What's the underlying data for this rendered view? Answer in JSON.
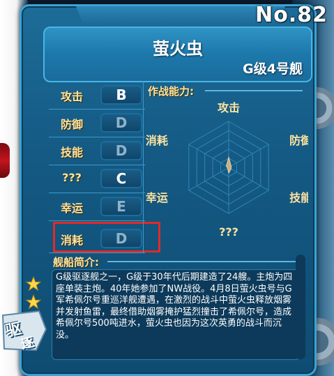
{
  "header": {
    "number": "No.82"
  },
  "ship": {
    "name": "萤火虫",
    "class": "G级4号舰"
  },
  "stats": [
    {
      "label": "攻击",
      "grade": "B",
      "active": true
    },
    {
      "label": "防御",
      "grade": "D",
      "active": false
    },
    {
      "label": "技能",
      "grade": "D",
      "active": false
    },
    {
      "label": "???",
      "grade": "C",
      "active": true
    },
    {
      "label": "幸运",
      "grade": "E",
      "active": false
    },
    {
      "label": "消耗",
      "grade": "D",
      "active": false
    }
  ],
  "radar": {
    "title": "作战能力:",
    "axes": [
      "攻击",
      "防御",
      "技能",
      "???",
      "幸运",
      "消耗"
    ],
    "values": [
      0.22,
      0.06,
      0.06,
      0.12,
      0.03,
      0.06
    ],
    "fill_color": "#c9b07a"
  },
  "description": {
    "title": "舰船简介:",
    "text": "G级驱逐舰之一，G级于30年代后期建造了24艘。主炮为四座单装主炮。40年她参加了NW战役。4月8日萤火虫号与G军希佩尔号重巡洋舰遭遇，在激烈的战斗中萤火虫释放烟雾并发射鱼雷，最终借助烟雾掩护猛烈撞击了希佩尔号，造成希佩尔号500吨进水，萤火虫也因为这次英勇的战斗而沉没。"
  },
  "rank": {
    "stars": 2,
    "type_line1": "驱",
    "type_line2": "逐"
  },
  "colors": {
    "highlight": "#e02a2a",
    "label_gold": "#ffe3a0"
  }
}
